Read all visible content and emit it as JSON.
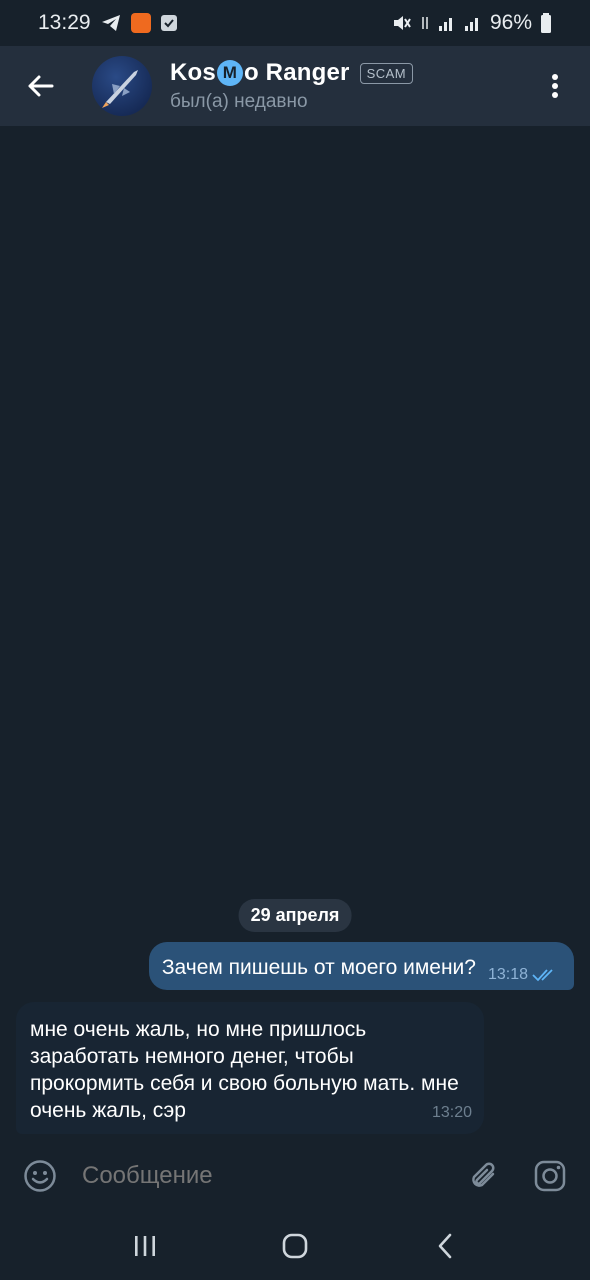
{
  "status_bar": {
    "time": "13:29",
    "battery": "96%"
  },
  "header": {
    "title_prefix": "Kos",
    "title_badge_letter": "M",
    "title_suffix": "o Ranger",
    "scam_label": "SCAM",
    "status": "был(а) недавно"
  },
  "chat": {
    "date_label": "29 апреля",
    "messages": [
      {
        "direction": "outgoing",
        "text": "Зачем пишешь от моего имени?",
        "time": "13:18"
      },
      {
        "direction": "incoming",
        "text": "мне очень жаль, но мне пришлось заработать немного денег, чтобы прокормить себя и свою больную мать. мне очень жаль, сэр",
        "time": "13:20"
      }
    ]
  },
  "composer": {
    "placeholder": "Сообщение"
  },
  "colors": {
    "background": "#17212b",
    "header": "#242f3d",
    "outgoing_bubble": "#2b5278",
    "incoming_bubble": "#182533",
    "accent": "#5eb5f7"
  }
}
